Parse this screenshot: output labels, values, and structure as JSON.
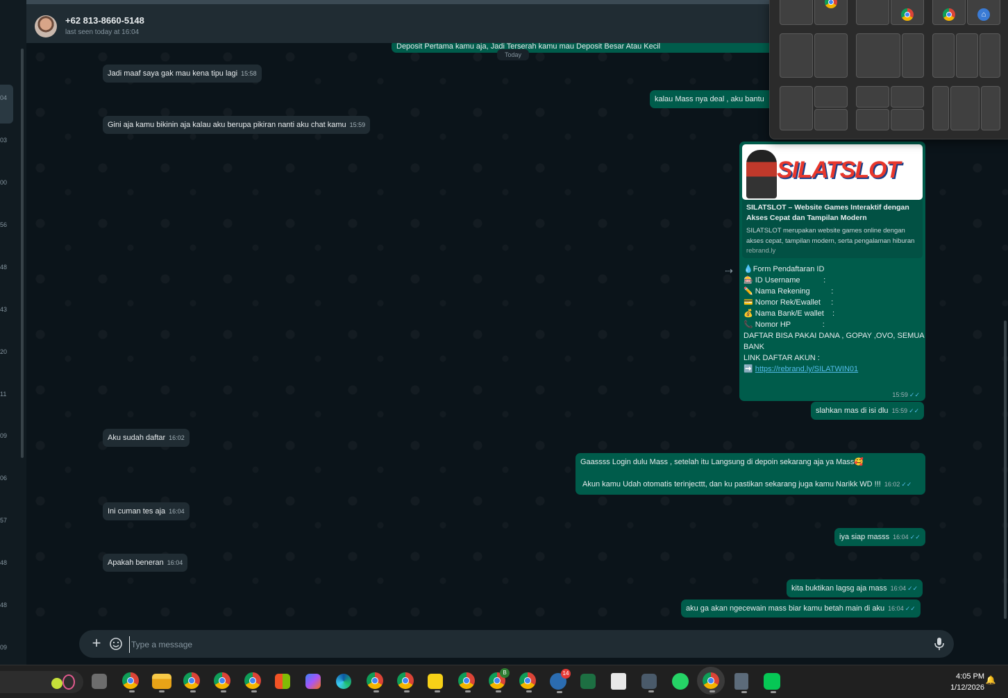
{
  "header": {
    "contact_name": "+62 813-8660-5148",
    "last_seen": "last seen today at 16:04"
  },
  "left_sidebar": {
    "time_fragments": [
      "04",
      "03",
      "00",
      "56",
      "48",
      "43",
      "20",
      "11",
      "09",
      "06",
      "57",
      "48",
      "48",
      "09"
    ]
  },
  "chat": {
    "date_chip": "Today",
    "top_partial_message": "Deposit Pertama kamu aja, Jadi Terserah kamu mau Deposit Besar Atau Kecil",
    "messages": [
      {
        "dir": "in",
        "text": "Jadi maaf saya gak mau kena tipu lagi",
        "time": "15:58"
      },
      {
        "dir": "out",
        "text": "kalau Mass nya deal , aku bantu",
        "time": ""
      },
      {
        "dir": "in",
        "text": "Gini aja kamu bikinin aja kalau aku berupa pikiran nanti aku chat kamu",
        "time": "15:59"
      },
      {
        "dir": "out",
        "text": "slahkan mas di isi dlu",
        "time": "15:59"
      },
      {
        "dir": "in",
        "text": "Aku sudah daftar",
        "time": "16:02"
      },
      {
        "dir": "out",
        "text": "Gaassss Login dulu Mass  , setelah itu Langsung di depoin sekarang aja ya Mass🥰",
        "text2": "Akun kamu Udah otomatis terinjecttt, dan ku pastikan sekarang juga kamu Narikk WD !!!",
        "time": "16:02"
      },
      {
        "dir": "in",
        "text": "Ini cuman tes aja",
        "time": "16:04"
      },
      {
        "dir": "out",
        "text": "iya siap masss",
        "time": "16:04"
      },
      {
        "dir": "in",
        "text": "Apakah beneran",
        "time": "16:04"
      },
      {
        "dir": "out",
        "text": "kita buktikan lagsg aja mass",
        "time": "16:04"
      },
      {
        "dir": "out",
        "text": "aku ga akan ngecewain mass biar kamu betah main di aku",
        "time": "16:04"
      }
    ],
    "link_card": {
      "banner_text": "SILATSLOT",
      "title": "SILATSLOT – Website Games Interaktif dengan Akses Cepat dan Tampilan Modern",
      "description": "SILATSLOT merupakan website games online dengan akses cepat, tampilan modern, serta pengalaman hiburan",
      "domain": "rebrand.ly",
      "form_lines": [
        "💧Form Pendaftaran ID",
        "",
        "🎰 ID Username           :",
        "✏️ Nama Rekening          :",
        "💳 Nomor Rek/Ewallet     :",
        "💰 Nama Bank/E wallet    :",
        "📞 Nomor HP               :",
        "",
        "DAFTAR BISA PAKAI DANA , GOPAY ,OVO, SEMUA",
        "BANK",
        "LINK DAFTAR AKUN :"
      ],
      "link_prefix": "➡️ ",
      "link": "https://rebrand.ly/SILATWIN01",
      "time": "15:59"
    }
  },
  "composer": {
    "placeholder": "Type a message"
  },
  "taskbar": {
    "time": "4:05 PM",
    "date": "1/12/2026",
    "badge_count": "14",
    "icons": [
      "search-box",
      "task-view-icon",
      "chrome-icon",
      "file-explorer-icon",
      "chrome-profile-icon",
      "chrome-profile-icon",
      "chrome-profile-icon",
      "microsoft-store-icon",
      "copilot-icon",
      "edge-icon",
      "chrome-profile-icon",
      "chrome-profile-icon",
      "sticky-notes-icon",
      "chrome-profile-icon",
      "chrome-profile-icon",
      "chrome-profile-icon",
      "github-desktop-icon",
      "excel-icon",
      "notepad-icon",
      "mail-icon",
      "whatsapp-icon",
      "chrome-profile-icon",
      "calculator-icon",
      "line-icon"
    ]
  },
  "colors": {
    "incoming_bubble": "#202c33",
    "outgoing_bubble": "#005c4b",
    "read_tick": "#53bdeb",
    "chat_bg": "#0b141a"
  }
}
